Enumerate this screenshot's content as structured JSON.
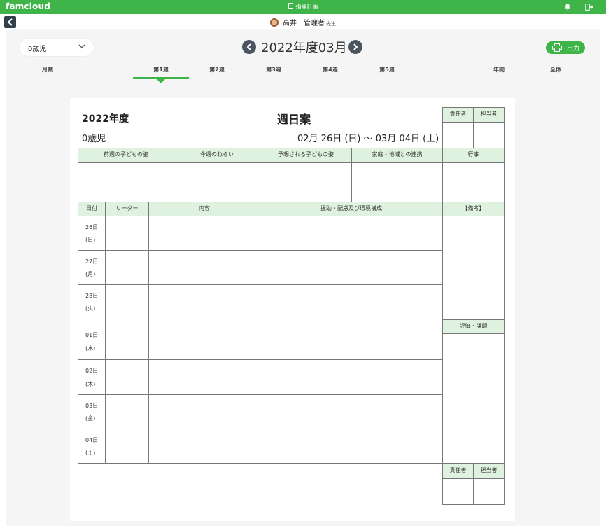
{
  "app": {
    "logo": "famcloud",
    "title": "指導計画"
  },
  "user": {
    "name": "高井　管理者",
    "suffix": "先生"
  },
  "filter": {
    "age_group": "0歳児"
  },
  "nav": {
    "month_title": "2022年度03月",
    "print_label": "出力"
  },
  "tabs": [
    {
      "label": "月案"
    },
    {
      "label": "第1週"
    },
    {
      "label": "第2週"
    },
    {
      "label": "第3週"
    },
    {
      "label": "第4週"
    },
    {
      "label": "第5週"
    },
    {
      "label": "年間"
    },
    {
      "label": "全体"
    }
  ],
  "active_tab": "第1週",
  "doc": {
    "year": "2022年度",
    "title": "週日案",
    "age": "0歳児",
    "date_range": "02月 26日 (日) ～ 03月 04日 (土)",
    "sign_headers": {
      "responsible": "責任者",
      "in_charge": "担当者"
    },
    "top_headers": [
      "前週の子どもの姿",
      "今週のねらい",
      "予想される子どもの姿",
      "家庭・地域との連携",
      "行事"
    ],
    "day_headers": {
      "date": "日付",
      "leader": "リーダー",
      "content": "内容",
      "support": "援助・配慮及び環境構成",
      "remarks": "【備考】"
    },
    "evaluation": "評価・課題",
    "days": [
      {
        "date": "26日",
        "dow": "(日)"
      },
      {
        "date": "27日",
        "dow": "(月)"
      },
      {
        "date": "28日",
        "dow": "(火)"
      },
      {
        "date": "01日",
        "dow": "(水)"
      },
      {
        "date": "02日",
        "dow": "(木)"
      },
      {
        "date": "03日",
        "dow": "(金)"
      },
      {
        "date": "04日",
        "dow": "(土)"
      }
    ]
  },
  "colors": {
    "brand": "#3fb449",
    "header_cell": "#dff2df",
    "dark_button": "#4a5560"
  }
}
